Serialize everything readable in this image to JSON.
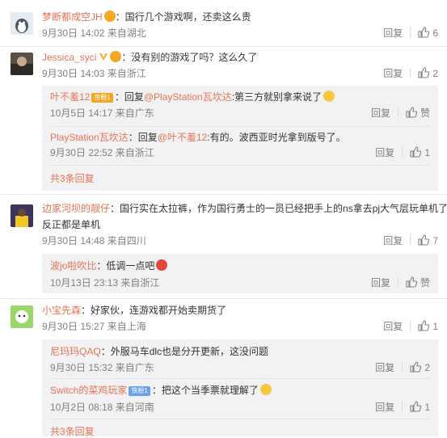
{
  "comments": [
    {
      "user": "梦断都成空JH",
      "text": "：国行几个游戏啊，还卖这么贵",
      "meta": "9月30日 14:02 来自湖北",
      "reply_label": "回复",
      "likes": "6"
    },
    {
      "user": "Jessica_syci",
      "text": "：没有别的游戏了吗？这么久了",
      "meta": "9月30日 14:03 来自浙江",
      "reply_label": "回复",
      "likes": "2",
      "replies": [
        {
          "user": "叶不羞12",
          "badge": "金粉1",
          "text_pre": "：回复",
          "mention": "@PlayStation瓦坎达",
          "text_post": ":第三方就别拿来说了",
          "meta": "10月5日 14:17 来自广东",
          "reply_label": "回复",
          "likes": "赞"
        },
        {
          "user": "PlayStation瓦坎达",
          "text_pre": "：回复",
          "mention": "@叶不羞12",
          "text_post": ":有的。波西亚时光拿到版号了。",
          "meta": "9月30日 22:52 来自浙江",
          "reply_label": "回复",
          "likes": "1"
        }
      ],
      "more": "共3条回复"
    },
    {
      "user": "边家河坝的靓仔",
      "text": "：国行实在太拉裤，作为国行勇士的一员已经把手上的ns拿去pj大气层玩单机了，",
      "text2": "反正都是单机",
      "meta": "9月30日 14:48 来自四川",
      "reply_label": "回复",
      "likes": "7",
      "replies": [
        {
          "user": "波jo啦吹比",
          "text_pre": "：低调一点吧",
          "meta": "10月13日 23:13 来自浙江",
          "reply_label": "回复",
          "likes": "赞"
        }
      ]
    },
    {
      "user": "小宝先森",
      "text": "：好家伙，连游戏都开始卖期货了",
      "meta": "9月30日 15:27 来自上海",
      "reply_label": "回复",
      "likes": "1",
      "replies": [
        {
          "user": "尼玛玛QAQ",
          "text_pre": "：外服马车dlc也是分开更新，这没问题",
          "meta": "9月30日 15:32 来自广东",
          "reply_label": "回复",
          "likes": "2"
        },
        {
          "user": "Switch的菜鸡玩家",
          "badge": "铁粉1",
          "text_pre": "：把这个当季票就理解了",
          "meta": "10月2日 08:18 来自河南",
          "reply_label": "回复",
          "likes": "1"
        }
      ],
      "more": "共3条回复"
    }
  ]
}
